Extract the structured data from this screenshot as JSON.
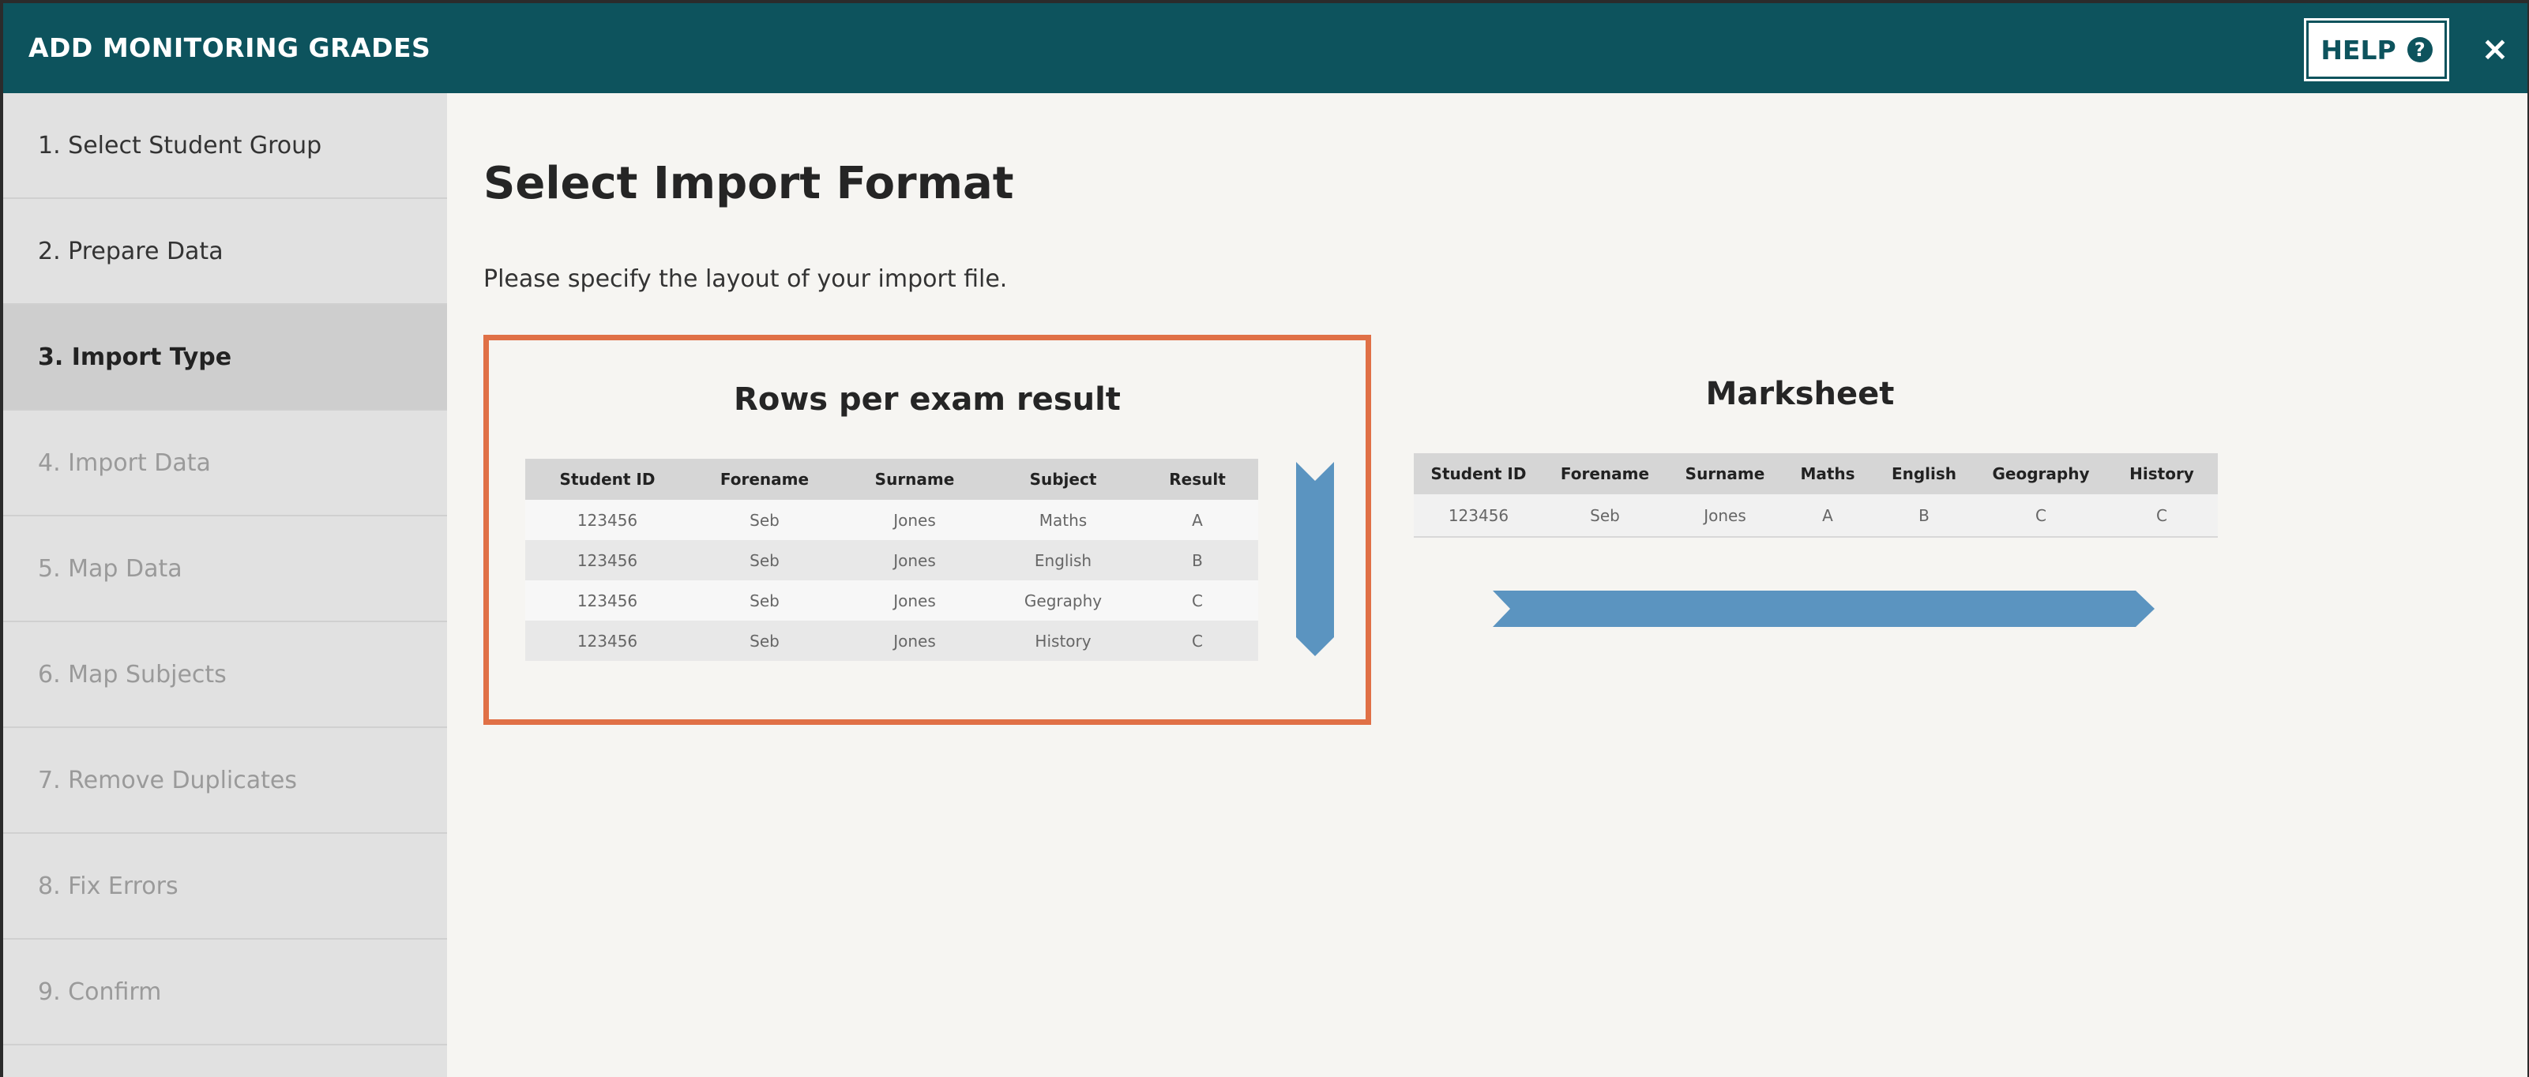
{
  "header": {
    "title": "ADD MONITORING GRADES",
    "help_label": "HELP",
    "help_icon": "?",
    "close_icon": "×"
  },
  "sidebar": {
    "steps": [
      {
        "label": "1. Select Student Group",
        "state": "done"
      },
      {
        "label": "2. Prepare Data",
        "state": "done"
      },
      {
        "label": "3. Import Type",
        "state": "active"
      },
      {
        "label": "4. Import Data",
        "state": "pending"
      },
      {
        "label": "5. Map Data",
        "state": "pending"
      },
      {
        "label": "6. Map Subjects",
        "state": "pending"
      },
      {
        "label": "7. Remove Duplicates",
        "state": "pending"
      },
      {
        "label": "8. Fix Errors",
        "state": "pending"
      },
      {
        "label": "9. Confirm",
        "state": "pending"
      }
    ]
  },
  "main": {
    "title": "Select Import Format",
    "description": "Please specify the layout of your import file.",
    "options": [
      {
        "title": "Rows per exam result",
        "selected": true,
        "columns": [
          "Student ID",
          "Forename",
          "Surname",
          "Subject",
          "Result"
        ],
        "rows": [
          [
            "123456",
            "Seb",
            "Jones",
            "Maths",
            "A"
          ],
          [
            "123456",
            "Seb",
            "Jones",
            "English",
            "B"
          ],
          [
            "123456",
            "Seb",
            "Jones",
            "Gegraphy",
            "C"
          ],
          [
            "123456",
            "Seb",
            "Jones",
            "History",
            "C"
          ]
        ]
      },
      {
        "title": "Marksheet",
        "selected": false,
        "columns": [
          "Student ID",
          "Forename",
          "Surname",
          "Maths",
          "English",
          "Geography",
          "History"
        ],
        "rows": [
          [
            "123456",
            "Seb",
            "Jones",
            "A",
            "B",
            "C",
            "C"
          ]
        ]
      }
    ]
  },
  "colors": {
    "header_bg": "#0d535d",
    "selected_border": "#e07046",
    "arrow": "#5b94c0",
    "sidebar_bg": "#e1e1e1",
    "sidebar_active_bg": "#cecece"
  }
}
